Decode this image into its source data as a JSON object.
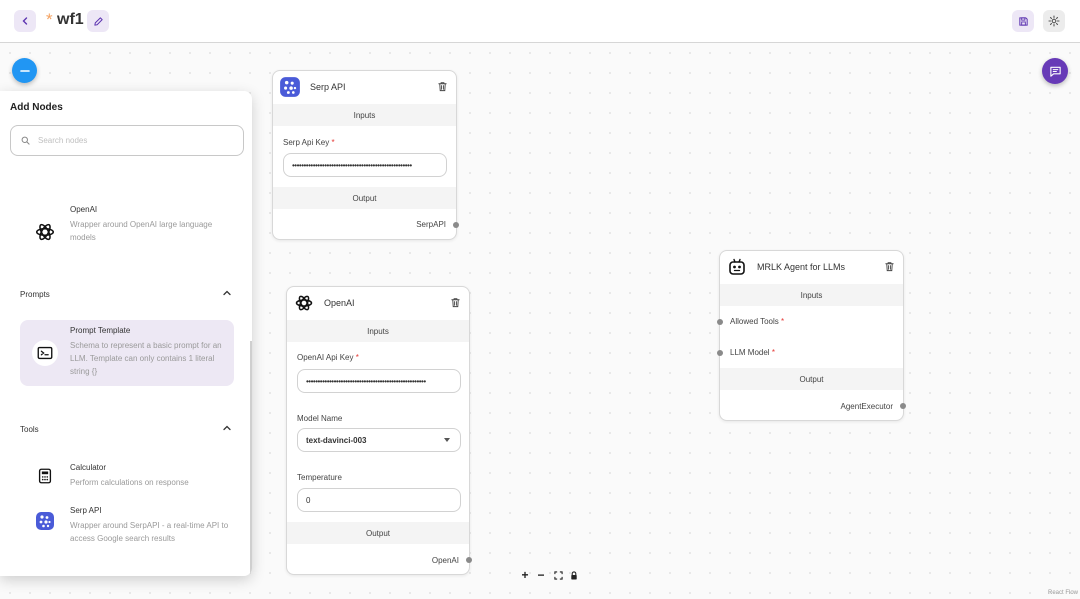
{
  "header": {
    "unsaved_marker": "*",
    "title": "wf1"
  },
  "panel": {
    "title": "Add Nodes",
    "search_placeholder": "Search nodes",
    "items_top": [
      {
        "name": "OpenAI",
        "description": "Wrapper around OpenAI large language models",
        "icon": "openai-icon"
      }
    ],
    "sections": [
      {
        "title": "Prompts",
        "items": [
          {
            "name": "Prompt Template",
            "description": "Schema to represent a basic prompt for an LLM. Template can only contains 1 literal string {}",
            "icon": "terminal-icon",
            "active": true
          }
        ]
      },
      {
        "title": "Tools",
        "items": [
          {
            "name": "Calculator",
            "description": "Perform calculations on response",
            "icon": "calculator-icon"
          },
          {
            "name": "Serp API",
            "description": "Wrapper around SerpAPI - a real-time API to access Google search results",
            "icon": "serpapi-icon"
          }
        ]
      }
    ]
  },
  "nodes": {
    "serp": {
      "title": "Serp API",
      "inputs_label": "Inputs",
      "field_label": "Serp Api Key",
      "field_value": "••••••••••••••••••••••••••••••••••••••••••••••••••••",
      "output_label": "Output",
      "output_name": "SerpAPI"
    },
    "openai": {
      "title": "OpenAI",
      "inputs_label": "Inputs",
      "api_key_label": "OpenAI Api Key",
      "api_key_value": "••••••••••••••••••••••••••••••••••••••••••••••••••••",
      "model_label": "Model Name",
      "model_value": "text-davinci-003",
      "temperature_label": "Temperature",
      "temperature_value": "0",
      "output_label": "Output",
      "output_name": "OpenAI"
    },
    "mrkl": {
      "title": "MRLK Agent for LLMs",
      "inputs_label": "Inputs",
      "input1": "Allowed Tools",
      "input2": "LLM Model",
      "output_label": "Output",
      "output_name": "AgentExecutor"
    }
  },
  "required_marker": "*",
  "controls": {
    "zoom_in": "+",
    "zoom_out": "−"
  },
  "attribution": "React Flow",
  "colors": {
    "accent": "#5e35b1",
    "fab_blue": "#2196f3",
    "fab_purple": "#673ab7",
    "required": "#e53935"
  }
}
